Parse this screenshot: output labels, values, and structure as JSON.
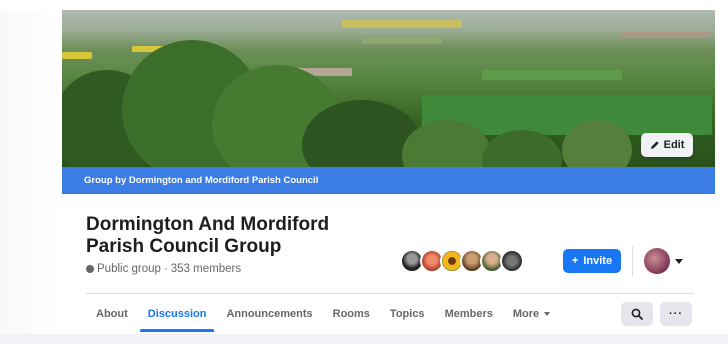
{
  "cover": {
    "edit_label": "Edit"
  },
  "banner": {
    "text": "Group by Dormington and Mordiford Parish Council"
  },
  "group": {
    "title": "Dormington And Mordiford Parish Council Group",
    "privacy": "Public group",
    "members": "353 members",
    "separator": "·"
  },
  "actions": {
    "invite_label": "Invite",
    "invite_prefix": "+"
  },
  "tabs": [
    {
      "label": "About"
    },
    {
      "label": "Discussion"
    },
    {
      "label": "Announcements"
    },
    {
      "label": "Rooms"
    },
    {
      "label": "Topics"
    },
    {
      "label": "Members"
    },
    {
      "label": "More"
    }
  ],
  "more_dots": "···",
  "colors": {
    "accent": "#1877f2",
    "banner": "#3b7de5"
  },
  "icons": {
    "edit": "pencil-icon",
    "search": "search-icon",
    "globe": "globe-icon",
    "more": "ellipsis-icon"
  }
}
